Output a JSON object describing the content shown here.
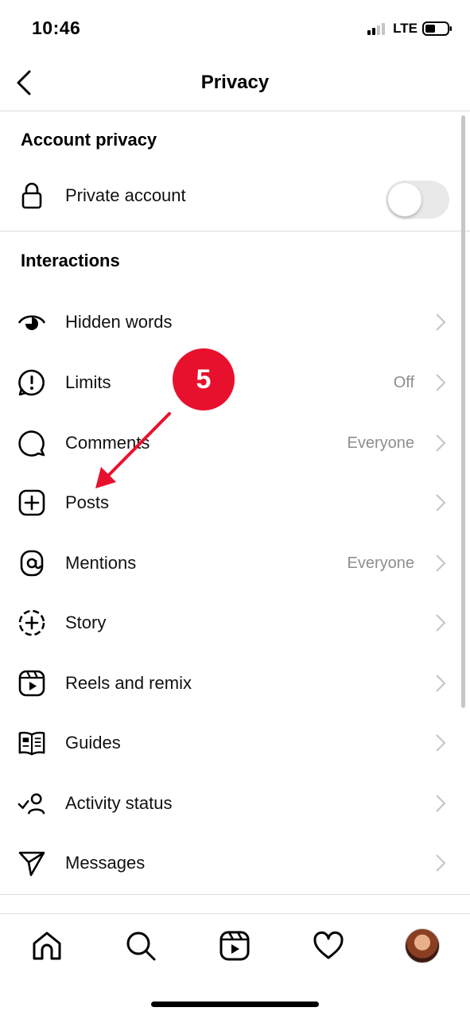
{
  "status_bar": {
    "time": "10:46",
    "network": "LTE"
  },
  "nav": {
    "title": "Privacy"
  },
  "account_privacy": {
    "header": "Account privacy",
    "private_account_label": "Private account",
    "private_account_enabled": false
  },
  "interactions": {
    "header": "Interactions",
    "items": [
      {
        "label": "Hidden words",
        "value": ""
      },
      {
        "label": "Limits",
        "value": "Off"
      },
      {
        "label": "Comments",
        "value": "Everyone"
      },
      {
        "label": "Posts",
        "value": ""
      },
      {
        "label": "Mentions",
        "value": "Everyone"
      },
      {
        "label": "Story",
        "value": ""
      },
      {
        "label": "Reels and remix",
        "value": ""
      },
      {
        "label": "Guides",
        "value": ""
      },
      {
        "label": "Activity status",
        "value": ""
      },
      {
        "label": "Messages",
        "value": ""
      }
    ]
  },
  "annotation": {
    "step": "5",
    "color": "#e8112d"
  },
  "tab_bar": {
    "items": [
      "home-icon",
      "search-icon",
      "reels-icon",
      "heart-icon",
      "profile-avatar"
    ]
  }
}
